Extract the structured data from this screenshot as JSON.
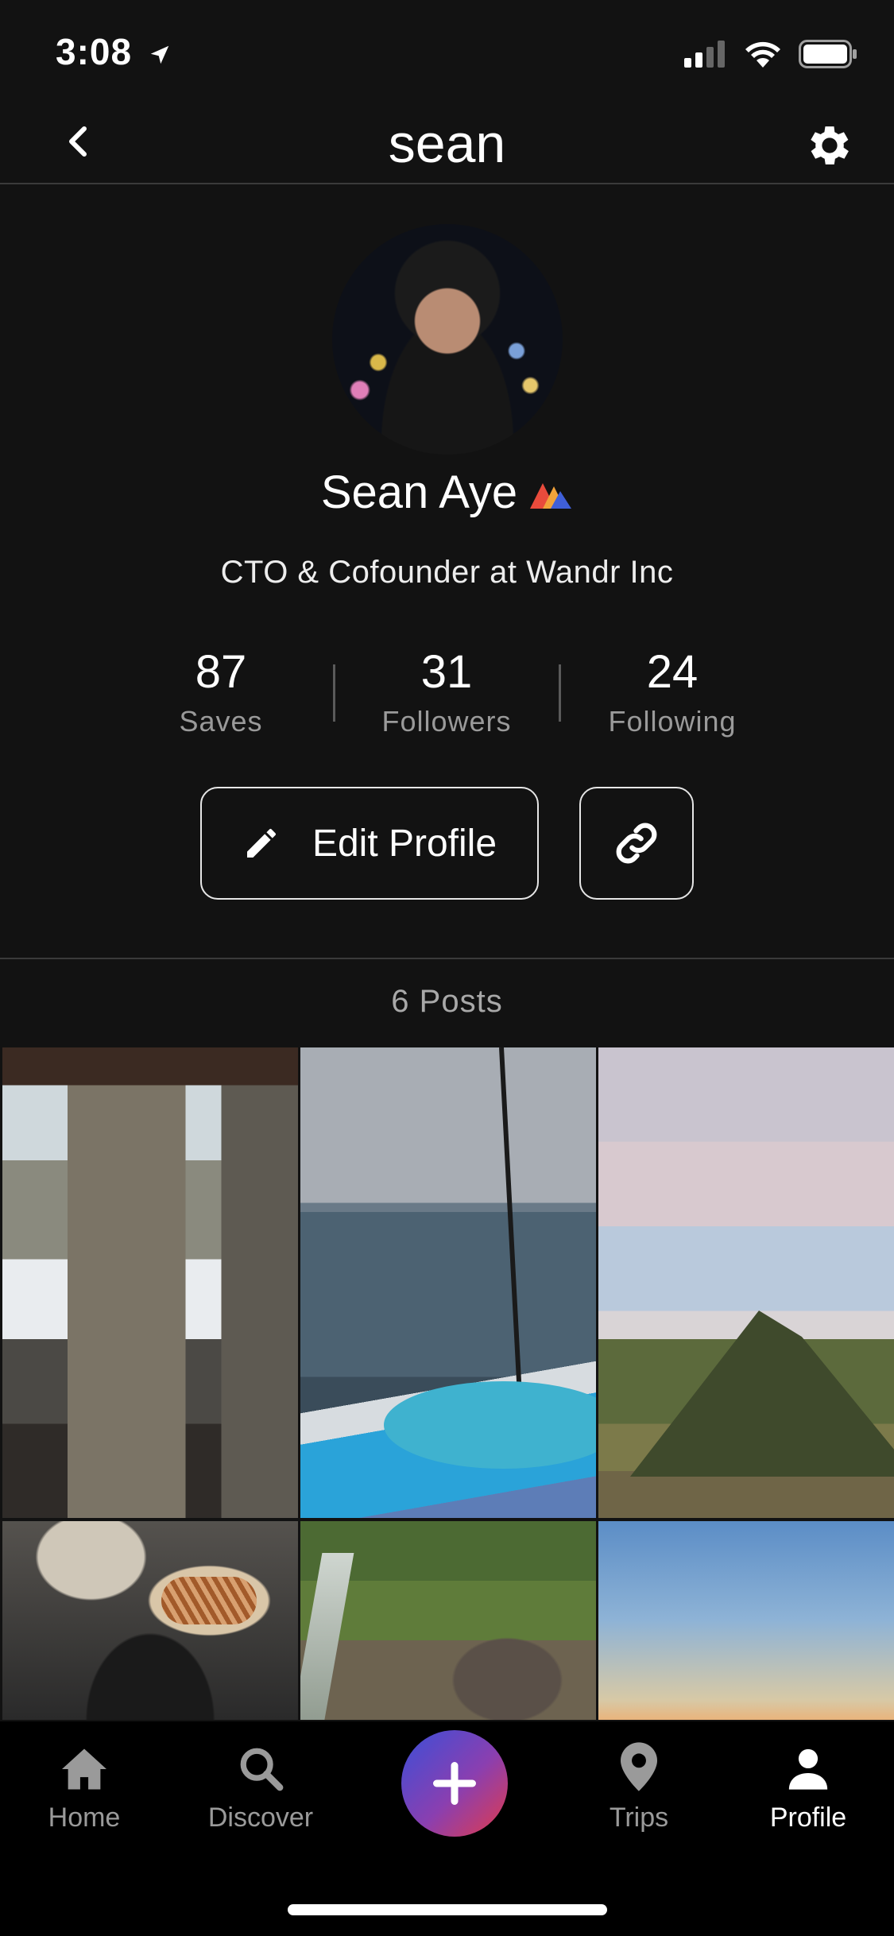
{
  "status_bar": {
    "time": "3:08"
  },
  "header": {
    "title": "sean"
  },
  "profile": {
    "name": "Sean Aye",
    "bio": "CTO & Cofounder at Wandr Inc",
    "stats": [
      {
        "value": "87",
        "label": "Saves"
      },
      {
        "value": "31",
        "label": "Followers"
      },
      {
        "value": "24",
        "label": "Following"
      }
    ],
    "edit_label": "Edit Profile"
  },
  "posts": {
    "count_label": "6 Posts"
  },
  "tabs": [
    {
      "label": "Home",
      "icon": "home-icon"
    },
    {
      "label": "Discover",
      "icon": "search-icon"
    },
    {
      "label": "Trips",
      "icon": "map-pin-icon"
    },
    {
      "label": "Profile",
      "icon": "person-icon"
    }
  ],
  "colors": {
    "background": "#121212",
    "tabbar": "#000000",
    "fab_start": "#3b4fd8",
    "fab_end": "#e23b4b"
  }
}
